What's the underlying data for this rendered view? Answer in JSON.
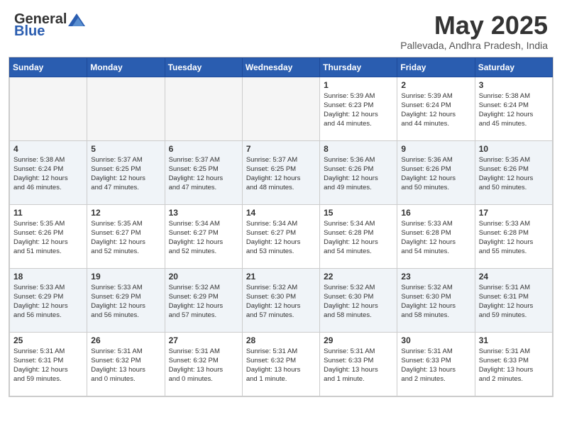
{
  "header": {
    "logo_general": "General",
    "logo_blue": "Blue",
    "month_title": "May 2025",
    "location": "Pallevada, Andhra Pradesh, India"
  },
  "calendar": {
    "days_of_week": [
      "Sunday",
      "Monday",
      "Tuesday",
      "Wednesday",
      "Thursday",
      "Friday",
      "Saturday"
    ],
    "weeks": [
      [
        {
          "day": "",
          "info": ""
        },
        {
          "day": "",
          "info": ""
        },
        {
          "day": "",
          "info": ""
        },
        {
          "day": "",
          "info": ""
        },
        {
          "day": "1",
          "info": "Sunrise: 5:39 AM\nSunset: 6:23 PM\nDaylight: 12 hours\nand 44 minutes."
        },
        {
          "day": "2",
          "info": "Sunrise: 5:39 AM\nSunset: 6:24 PM\nDaylight: 12 hours\nand 44 minutes."
        },
        {
          "day": "3",
          "info": "Sunrise: 5:38 AM\nSunset: 6:24 PM\nDaylight: 12 hours\nand 45 minutes."
        }
      ],
      [
        {
          "day": "4",
          "info": "Sunrise: 5:38 AM\nSunset: 6:24 PM\nDaylight: 12 hours\nand 46 minutes."
        },
        {
          "day": "5",
          "info": "Sunrise: 5:37 AM\nSunset: 6:25 PM\nDaylight: 12 hours\nand 47 minutes."
        },
        {
          "day": "6",
          "info": "Sunrise: 5:37 AM\nSunset: 6:25 PM\nDaylight: 12 hours\nand 47 minutes."
        },
        {
          "day": "7",
          "info": "Sunrise: 5:37 AM\nSunset: 6:25 PM\nDaylight: 12 hours\nand 48 minutes."
        },
        {
          "day": "8",
          "info": "Sunrise: 5:36 AM\nSunset: 6:26 PM\nDaylight: 12 hours\nand 49 minutes."
        },
        {
          "day": "9",
          "info": "Sunrise: 5:36 AM\nSunset: 6:26 PM\nDaylight: 12 hours\nand 50 minutes."
        },
        {
          "day": "10",
          "info": "Sunrise: 5:35 AM\nSunset: 6:26 PM\nDaylight: 12 hours\nand 50 minutes."
        }
      ],
      [
        {
          "day": "11",
          "info": "Sunrise: 5:35 AM\nSunset: 6:26 PM\nDaylight: 12 hours\nand 51 minutes."
        },
        {
          "day": "12",
          "info": "Sunrise: 5:35 AM\nSunset: 6:27 PM\nDaylight: 12 hours\nand 52 minutes."
        },
        {
          "day": "13",
          "info": "Sunrise: 5:34 AM\nSunset: 6:27 PM\nDaylight: 12 hours\nand 52 minutes."
        },
        {
          "day": "14",
          "info": "Sunrise: 5:34 AM\nSunset: 6:27 PM\nDaylight: 12 hours\nand 53 minutes."
        },
        {
          "day": "15",
          "info": "Sunrise: 5:34 AM\nSunset: 6:28 PM\nDaylight: 12 hours\nand 54 minutes."
        },
        {
          "day": "16",
          "info": "Sunrise: 5:33 AM\nSunset: 6:28 PM\nDaylight: 12 hours\nand 54 minutes."
        },
        {
          "day": "17",
          "info": "Sunrise: 5:33 AM\nSunset: 6:28 PM\nDaylight: 12 hours\nand 55 minutes."
        }
      ],
      [
        {
          "day": "18",
          "info": "Sunrise: 5:33 AM\nSunset: 6:29 PM\nDaylight: 12 hours\nand 56 minutes."
        },
        {
          "day": "19",
          "info": "Sunrise: 5:33 AM\nSunset: 6:29 PM\nDaylight: 12 hours\nand 56 minutes."
        },
        {
          "day": "20",
          "info": "Sunrise: 5:32 AM\nSunset: 6:29 PM\nDaylight: 12 hours\nand 57 minutes."
        },
        {
          "day": "21",
          "info": "Sunrise: 5:32 AM\nSunset: 6:30 PM\nDaylight: 12 hours\nand 57 minutes."
        },
        {
          "day": "22",
          "info": "Sunrise: 5:32 AM\nSunset: 6:30 PM\nDaylight: 12 hours\nand 58 minutes."
        },
        {
          "day": "23",
          "info": "Sunrise: 5:32 AM\nSunset: 6:30 PM\nDaylight: 12 hours\nand 58 minutes."
        },
        {
          "day": "24",
          "info": "Sunrise: 5:31 AM\nSunset: 6:31 PM\nDaylight: 12 hours\nand 59 minutes."
        }
      ],
      [
        {
          "day": "25",
          "info": "Sunrise: 5:31 AM\nSunset: 6:31 PM\nDaylight: 12 hours\nand 59 minutes."
        },
        {
          "day": "26",
          "info": "Sunrise: 5:31 AM\nSunset: 6:32 PM\nDaylight: 13 hours\nand 0 minutes."
        },
        {
          "day": "27",
          "info": "Sunrise: 5:31 AM\nSunset: 6:32 PM\nDaylight: 13 hours\nand 0 minutes."
        },
        {
          "day": "28",
          "info": "Sunrise: 5:31 AM\nSunset: 6:32 PM\nDaylight: 13 hours\nand 1 minute."
        },
        {
          "day": "29",
          "info": "Sunrise: 5:31 AM\nSunset: 6:33 PM\nDaylight: 13 hours\nand 1 minute."
        },
        {
          "day": "30",
          "info": "Sunrise: 5:31 AM\nSunset: 6:33 PM\nDaylight: 13 hours\nand 2 minutes."
        },
        {
          "day": "31",
          "info": "Sunrise: 5:31 AM\nSunset: 6:33 PM\nDaylight: 13 hours\nand 2 minutes."
        }
      ]
    ]
  }
}
